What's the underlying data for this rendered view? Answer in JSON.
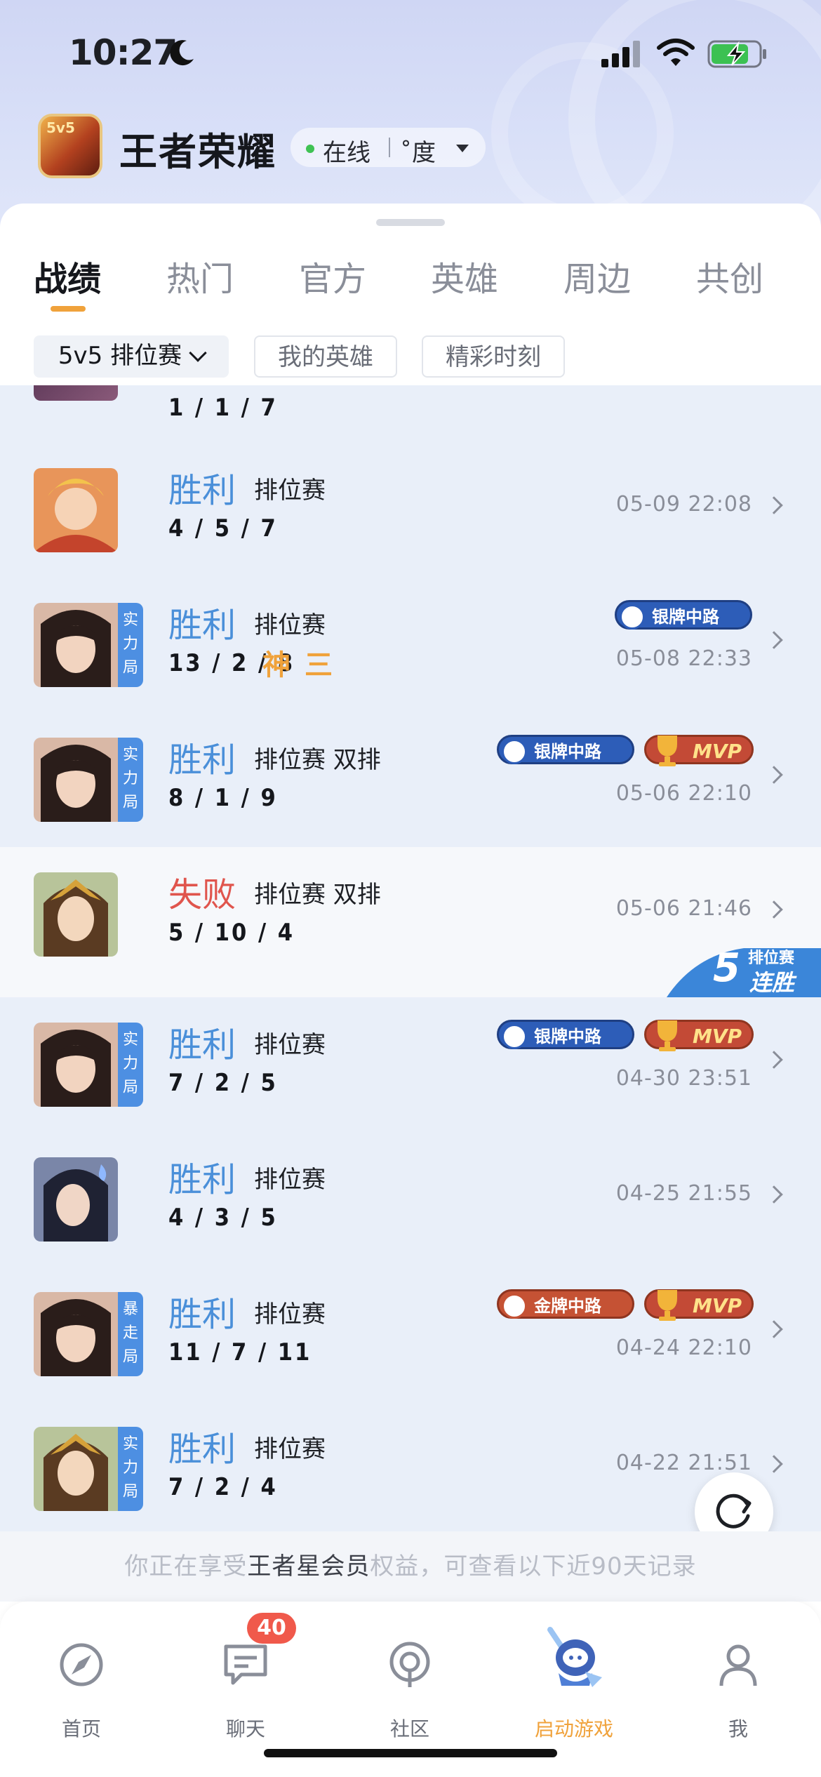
{
  "status_bar": {
    "time": "10:27"
  },
  "header": {
    "app_title": "王者荣耀",
    "online_status": "在线",
    "status_extra": "˚度"
  },
  "tabs": [
    {
      "label": "战绩",
      "active": true
    },
    {
      "label": "热门",
      "active": false
    },
    {
      "label": "官方",
      "active": false
    },
    {
      "label": "英雄",
      "active": false
    },
    {
      "label": "周边",
      "active": false
    },
    {
      "label": "共创",
      "active": false
    }
  ],
  "filters": {
    "mode_select": "5v5 排位赛",
    "my_heroes": "我的英雄",
    "highlights": "精彩时刻"
  },
  "partial_row": {
    "kda": "1 / 1 / 7"
  },
  "matches": [
    {
      "result": "胜利",
      "mode": "排位赛",
      "kda": "4 / 5 / 7",
      "time": "05-09 22:08"
    },
    {
      "result": "胜利",
      "mode": "排位赛",
      "kda": "13 / 2 / 8",
      "time": "05-08 22:33",
      "avatar_tag": "实力局",
      "badges": [
        "银牌中路"
      ],
      "honors": [
        "神",
        "三"
      ]
    },
    {
      "result": "胜利",
      "mode": "排位赛 双排",
      "kda": "8 / 1 / 9",
      "time": "05-06 22:10",
      "avatar_tag": "实力局",
      "badges": [
        "银牌中路",
        "MVP"
      ]
    },
    {
      "result": "失败",
      "mode": "排位赛 双排",
      "kda": "5 / 10 / 4",
      "time": "05-06 21:46",
      "streak_top": "排位赛",
      "streak_bottom": "连胜",
      "streak_count": "5"
    },
    {
      "result": "胜利",
      "mode": "排位赛",
      "kda": "7 / 2 / 5",
      "time": "04-30 23:51",
      "avatar_tag": "实力局",
      "badges": [
        "银牌中路",
        "MVP"
      ]
    },
    {
      "result": "胜利",
      "mode": "排位赛",
      "kda": "4 / 3 / 5",
      "time": "04-25 21:55"
    },
    {
      "result": "胜利",
      "mode": "排位赛",
      "kda": "11 / 7 / 11",
      "time": "04-24 22:10",
      "avatar_tag": "暴走局",
      "badges": [
        "金牌中路",
        "MVP"
      ]
    },
    {
      "result": "胜利",
      "mode": "排位赛",
      "kda": "7 / 2 / 4",
      "time": "04-22 21:51",
      "avatar_tag": "实力局"
    }
  ],
  "footer_note": {
    "prefix": "你正在享受",
    "highlight": "王者星会员",
    "suffix": "权益，可查看以下近90天记录"
  },
  "tabbar": [
    {
      "label": "首页",
      "icon": "compass-icon"
    },
    {
      "label": "聊天",
      "icon": "chat-icon",
      "badge": "40"
    },
    {
      "label": "社区",
      "icon": "community-icon"
    },
    {
      "label": "启动游戏",
      "icon": "launch-game-icon",
      "active": true
    },
    {
      "label": "我",
      "icon": "profile-icon"
    }
  ],
  "colors": {
    "win": "#4a8fd9",
    "lose": "#e0554d",
    "accent": "#f0a23b",
    "silver_badge": "#2d5db8",
    "gold_badge": "#c55234"
  }
}
